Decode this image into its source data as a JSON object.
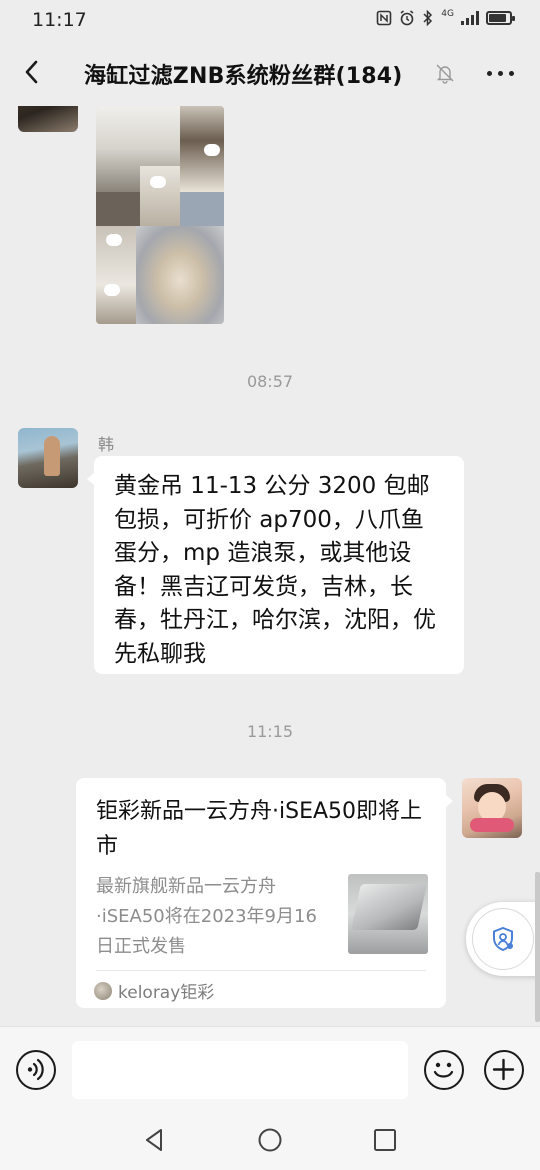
{
  "status_bar": {
    "time": "11:17",
    "network": "4G",
    "battery_level": 0.75
  },
  "header": {
    "title": "海缸过滤ZNB系统粉丝群(184)",
    "back_icon": "chevron-left-icon",
    "mute_icon": "bell-muted-icon",
    "more_icon": "more-dots-icon"
  },
  "messages": {
    "timestamp_1": "08:57",
    "sender_1": "韩",
    "text_1": "黄金吊 11-13 公分 3200 包邮包损，可折价 ap700，八爪鱼蛋分，mp 造浪泵，或其他设备！黑吉辽可发货，吉林，长春，牡丹江，哈尔滨，沈阳，优先私聊我",
    "timestamp_2": "11:15",
    "card": {
      "title": "钜彩新品一云方舟·iSEA50即将上市",
      "description": "最新旗舰新品一云方舟·iSEA50将在2023年9月16日正式发售",
      "source": "keloray钜彩"
    }
  },
  "input_bar": {
    "voice_icon": "voice-icon",
    "emoji_icon": "emoji-icon",
    "plus_icon": "plus-icon"
  },
  "nav_bar": {
    "back_icon": "nav-back-triangle-icon",
    "home_icon": "nav-home-circle-icon",
    "recents_icon": "nav-recents-square-icon"
  }
}
